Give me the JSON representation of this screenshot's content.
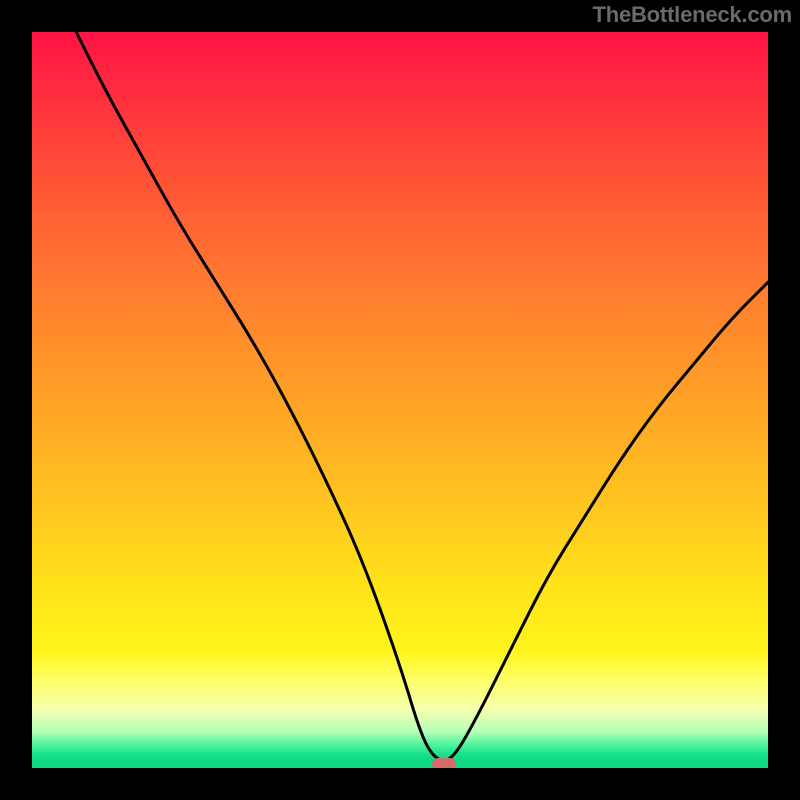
{
  "watermark": "TheBottleneck.com",
  "chart_data": {
    "type": "line",
    "title": "",
    "xlabel": "",
    "ylabel": "",
    "xlim": [
      0,
      100
    ],
    "ylim": [
      0,
      100
    ],
    "grid": false,
    "background_gradient": {
      "direction": "vertical",
      "stops": [
        {
          "pos": 0.0,
          "color": "#ff1344"
        },
        {
          "pos": 0.2,
          "color": "#ff5236"
        },
        {
          "pos": 0.5,
          "color": "#ffa226"
        },
        {
          "pos": 0.76,
          "color": "#ffe41a"
        },
        {
          "pos": 0.88,
          "color": "#fdff66"
        },
        {
          "pos": 0.95,
          "color": "#b6ffb6"
        },
        {
          "pos": 0.98,
          "color": "#17e08a"
        },
        {
          "pos": 1.0,
          "color": "#0fd985"
        }
      ]
    },
    "series": [
      {
        "name": "bottleneck-curve",
        "color": "#000000",
        "x": [
          6,
          10,
          15,
          20,
          25,
          30,
          35,
          40,
          45,
          50,
          53,
          55,
          57,
          60,
          65,
          70,
          75,
          80,
          85,
          90,
          95,
          100
        ],
        "y": [
          100,
          92,
          83,
          74,
          66,
          58,
          49,
          39,
          28,
          14,
          4,
          1,
          1,
          6,
          16,
          26,
          34,
          42,
          49,
          55,
          61,
          66
        ]
      }
    ],
    "marker": {
      "x": 56,
      "y": 0.5,
      "color": "#d46a6a",
      "shape": "pill"
    }
  },
  "colors": {
    "frame": "#000000",
    "curve": "#000000",
    "marker": "#d46a6a",
    "watermark": "#6a6a6a"
  }
}
